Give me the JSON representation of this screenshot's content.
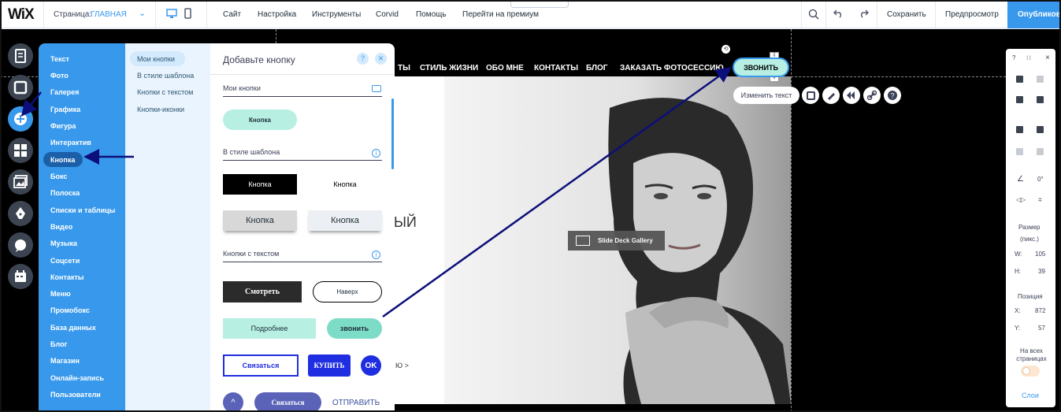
{
  "topbar": {
    "logo": "WiX",
    "page_label": "Страница:",
    "page_name": "ГЛАВНАЯ",
    "menu": [
      "Сайт",
      "Настройка",
      "Инструменты",
      "Corvid",
      "Помощь",
      "Перейти на премиум"
    ],
    "save": "Сохранить",
    "preview": "Предпросмотр",
    "publish": "Опубликовать"
  },
  "site_menu": [
    "ТЫ",
    "СТИЛЬ ЖИЗНИ",
    "ОБО МНЕ",
    "КОНТАКТЫ",
    "БЛОГ",
    "ЗАКАЗАТЬ ФОТОСЕССИЮ"
  ],
  "site_fragments": {
    "heading_tail": "ЫЙ",
    "link_tail": "Ю >"
  },
  "call_button": "ЗВОНИТЬ",
  "change_text": "Изменить текст",
  "gallery_label": "Slide Deck Gallery",
  "add_panel": {
    "categories": [
      "Текст",
      "Фото",
      "Галерея",
      "Графика",
      "Фигура",
      "Интерактив",
      "Кнопка",
      "Бокс",
      "Полоска",
      "Списки и таблицы",
      "Видео",
      "Музыка",
      "Соцсети",
      "Контакты",
      "Меню",
      "Промобокс",
      "База данных",
      "Блог",
      "Магазин",
      "Онлайн-запись",
      "Пользователи"
    ],
    "subcategories": [
      "Мои кнопки",
      "В стиле шаблона",
      "Кнопки с текстом",
      "Кнопки-иконки"
    ],
    "title": "Добавьте кнопку",
    "help": "?",
    "close": "×",
    "sections": {
      "my_buttons": "Мои кнопки",
      "themed": "В стиле шаблона",
      "text_buttons": "Кнопки с текстом"
    },
    "buttons": {
      "my_button": "Кнопка",
      "themed_black": "Кнопка",
      "themed_plain": "Кнопка",
      "themed_gray": "Кнопка",
      "themed_light": "Кнопка",
      "watch": "Смотреть",
      "up": "Наверх",
      "more": "Подробнее",
      "call": "звонить",
      "contact": "Связаться",
      "buy": "КУПИТЬ",
      "ok": "OK",
      "caret": "^",
      "contact2": "Связаться",
      "send": "ОТПРАВИТЬ"
    }
  },
  "right_panel": {
    "help": "?",
    "close": "×",
    "rotation": "0°",
    "size_label": "Размер",
    "size_unit": "(пикс.)",
    "w_label": "W:",
    "w_value": "105",
    "h_label": "H:",
    "h_value": "39",
    "pos_label": "Позиция",
    "x_label": "X:",
    "x_value": "872",
    "y_label": "Y:",
    "y_value": "57",
    "all_pages": "На всех страницах",
    "layers": "Слои"
  },
  "colors": {
    "accent": "#3899ec",
    "panel_bg": "#eaf4fe",
    "mint": "#b7f0e3",
    "arrow": "#0c0f7a",
    "dark_btn": "#2b2b2b",
    "blue_btn": "#1f2ee0",
    "purple_btn": "#5b63b8"
  }
}
